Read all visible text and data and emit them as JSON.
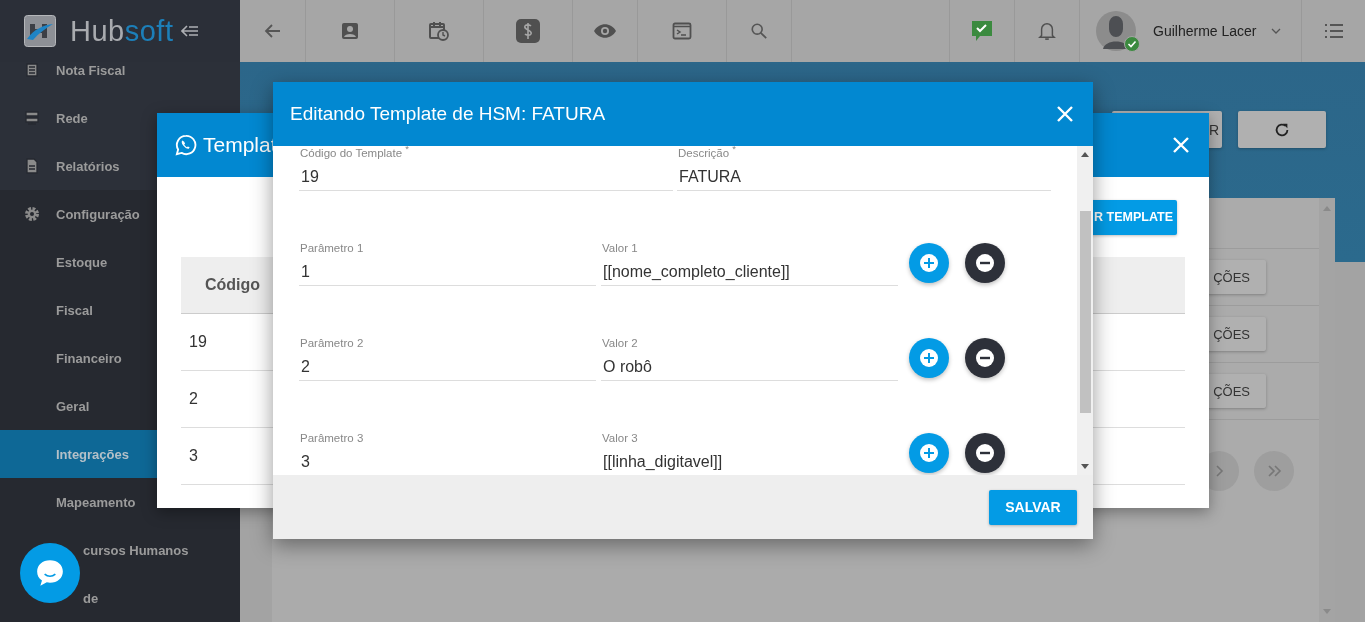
{
  "header": {
    "logo": {
      "part_1": "Hub",
      "part_2": "soft"
    },
    "user": {
      "name": "Guilherme Lacer",
      "online": true
    }
  },
  "sidebar": {
    "items": [
      {
        "label": "Nota Fiscal"
      },
      {
        "label": "Rede"
      },
      {
        "label": "Relatórios"
      },
      {
        "label": "Configuração",
        "children": [
          {
            "label": "Estoque",
            "selected": false,
            "covered": false
          },
          {
            "label": "Fiscal",
            "selected": false,
            "covered": false
          },
          {
            "label": "Financeiro",
            "selected": false,
            "covered": false
          },
          {
            "label": "Geral",
            "selected": false,
            "covered": false
          },
          {
            "label": "Integrações",
            "selected": true,
            "covered": false
          },
          {
            "label": "Mapeamento",
            "selected": false,
            "covered": false
          },
          {
            "label": "cursos Humanos",
            "selected": false,
            "covered": true
          },
          {
            "label": "de",
            "selected": false,
            "covered": true
          }
        ]
      }
    ]
  },
  "page": {
    "toolbar_button": "R",
    "rows": [
      {
        "action": "ÇÕES"
      },
      {
        "action": "ÇÕES"
      },
      {
        "action": "ÇÕES"
      }
    ]
  },
  "template_dialog": {
    "title": "Templat",
    "add_button": "R TEMPLATE",
    "table": {
      "columns": [
        "Código"
      ],
      "rows": [
        [
          "19"
        ],
        [
          "2"
        ],
        [
          "3"
        ]
      ]
    }
  },
  "edit_dialog": {
    "title": "Editando Template de HSM: FATURA",
    "fields": [
      {
        "label": "Código do Template $^{*}$",
        "value": "19"
      },
      {
        "label": "Descrição $^{*}$",
        "value": "FATURA"
      }
    ],
    "parameters": [
      {
        "label": "Parâmetro 1",
        "value": "1",
        "value_label": "Valor 1",
        "value_text": "[[nome_completo_cliente]]"
      },
      {
        "label": "Parâmetro 2",
        "value": "2",
        "value_label": "Valor 2",
        "value_text": "O robô"
      },
      {
        "label": "Parâmetro 3",
        "value": "3",
        "value_label": "Valor 3",
        "value_text": "[[linha_digitavel]]"
      }
    ],
    "save_button": "SALVAR"
  }
}
